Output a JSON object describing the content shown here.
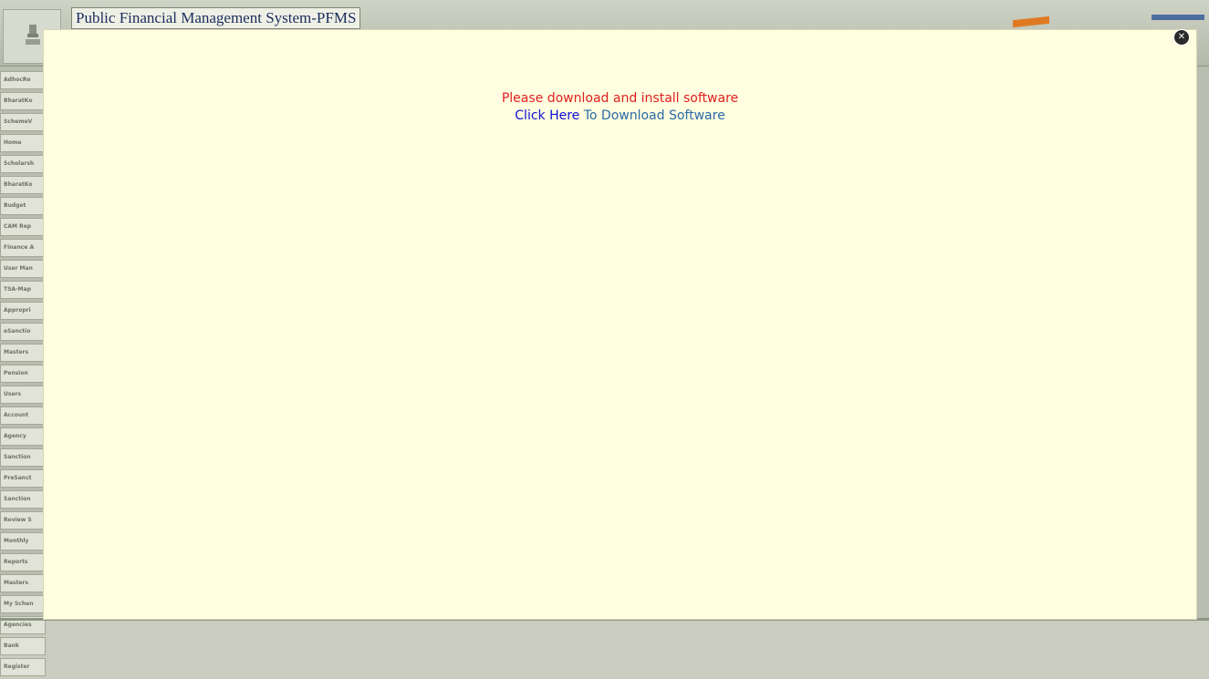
{
  "header": {
    "title": "Public Financial Management System-PFMS"
  },
  "sidebar": {
    "items": [
      "AdhocRe",
      "BharatKo",
      "SchemeV",
      "Home",
      "Scholarsh",
      "BharatKo",
      "Budget",
      "CAM Rep",
      "Finance A",
      "User Man",
      "TSA-Map",
      "Appropri",
      "eSanctio",
      "Masters",
      "Pension",
      "Users",
      "Account",
      "Agency",
      "Sanction",
      "PreSanct",
      "Sanction",
      "Review S",
      "Monthly",
      "Reports",
      "Masters",
      "My Schen",
      "Agencies",
      "Bank",
      "Register"
    ]
  },
  "modal": {
    "message": "Please download and install software",
    "link_text": "Click Here",
    "link_suffix": " To Download Software",
    "close_icon": "close-icon"
  },
  "colors": {
    "modal_bg": "#fffee0",
    "message": "#e02020",
    "link": "#1010d8"
  }
}
